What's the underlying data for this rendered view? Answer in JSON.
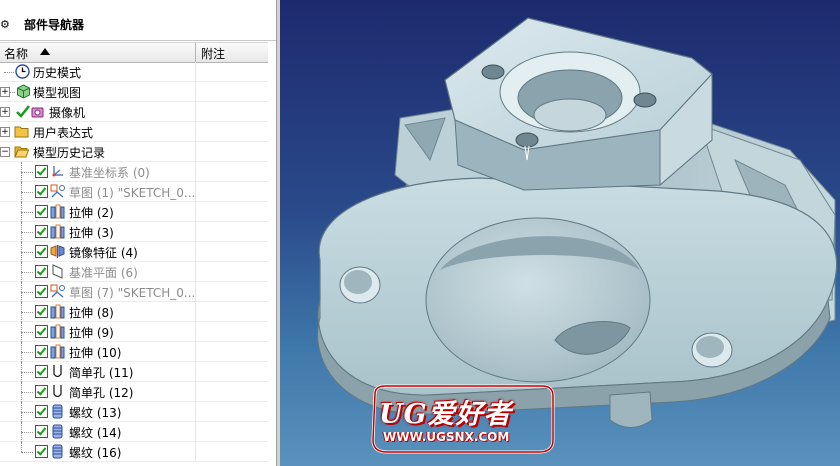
{
  "navigator": {
    "title": "部件导航器",
    "title_icon": "gear-icon",
    "columns": {
      "name": "名称",
      "note": "附注"
    },
    "rows": [
      {
        "label": "历史模式",
        "icon": "clock-icon",
        "greyed": false,
        "checked": false
      },
      {
        "label": "模型视图",
        "icon": "cube-view-icon",
        "greyed": false,
        "checked": false
      },
      {
        "label": "摄像机",
        "icon": "camera-icon",
        "greyed": false,
        "checked": true
      },
      {
        "label": "用户表达式",
        "icon": "folder-icon",
        "greyed": false,
        "checked": false
      },
      {
        "label": "模型历史记录",
        "icon": "folder-open-icon",
        "greyed": false,
        "checked": false
      },
      {
        "label": "基准坐标系 (0)",
        "icon": "datum-csys-icon",
        "greyed": true,
        "checked": true
      },
      {
        "label": "草图 (1) \"SKETCH_0...",
        "icon": "sketch-icon",
        "greyed": true,
        "checked": true
      },
      {
        "label": "拉伸 (2)",
        "icon": "extrude-icon",
        "greyed": false,
        "checked": true
      },
      {
        "label": "拉伸 (3)",
        "icon": "extrude-icon",
        "greyed": false,
        "checked": true
      },
      {
        "label": "镜像特征 (4)",
        "icon": "mirror-feature-icon",
        "greyed": false,
        "checked": true
      },
      {
        "label": "基准平面 (6)",
        "icon": "datum-plane-icon",
        "greyed": true,
        "checked": true
      },
      {
        "label": "草图 (7) \"SKETCH_0...",
        "icon": "sketch-icon",
        "greyed": true,
        "checked": true
      },
      {
        "label": "拉伸 (8)",
        "icon": "extrude-icon",
        "greyed": false,
        "checked": true
      },
      {
        "label": "拉伸 (9)",
        "icon": "extrude-icon",
        "greyed": false,
        "checked": true
      },
      {
        "label": "拉伸 (10)",
        "icon": "extrude-icon",
        "greyed": false,
        "checked": true
      },
      {
        "label": "简单孔 (11)",
        "icon": "hole-icon",
        "greyed": false,
        "checked": true
      },
      {
        "label": "简单孔 (12)",
        "icon": "hole-icon",
        "greyed": false,
        "checked": true
      },
      {
        "label": "螺纹 (13)",
        "icon": "thread-icon",
        "greyed": false,
        "checked": true
      },
      {
        "label": "螺纹 (14)",
        "icon": "thread-icon",
        "greyed": false,
        "checked": true
      },
      {
        "label": "螺纹 (16)",
        "icon": "thread-icon",
        "greyed": false,
        "checked": true
      }
    ]
  },
  "watermark": {
    "word": "UG爱好者",
    "url": "WWW.UGSNX.COM"
  },
  "colors": {
    "viewport_top": "#1d2a6e",
    "viewport_bottom": "#5a92bd",
    "part": "#c9dde3",
    "check": "#1a9a1a",
    "watermark": "#c00000"
  }
}
